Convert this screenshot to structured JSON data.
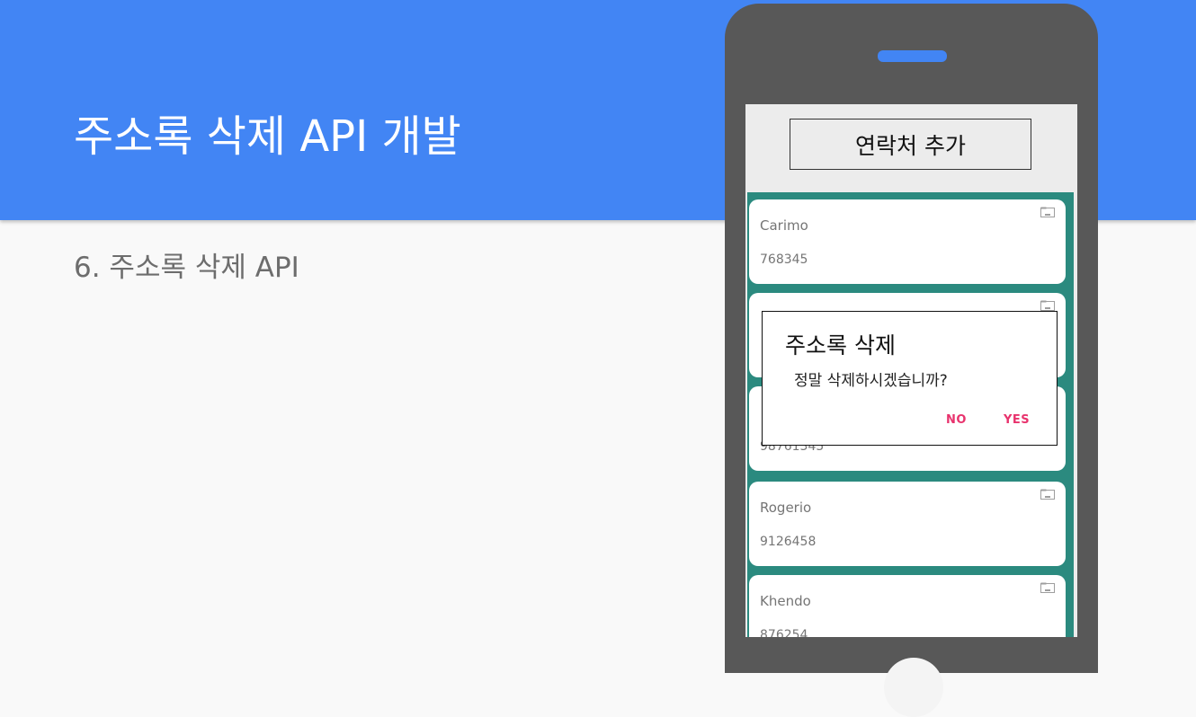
{
  "slide": {
    "title": "주소록 삭제 API 개발",
    "subtitle": "6. 주소록 삭제 API"
  },
  "app": {
    "add_button_label": "연락처 추가",
    "contacts": [
      {
        "name": "Carimo",
        "phone": "768345"
      },
      {
        "name": "",
        "phone": ""
      },
      {
        "name": "",
        "phone": "98761345"
      },
      {
        "name": "Rogerio",
        "phone": "9126458"
      },
      {
        "name": "Khendo",
        "phone": "876254"
      }
    ],
    "dialog": {
      "title": "주소록 삭제",
      "message": "정말 삭제하시겠습니까?",
      "no_label": "NO",
      "yes_label": "YES"
    }
  },
  "colors": {
    "header_bg": "#4285f4",
    "list_bg": "#2b8a7f",
    "dialog_button": "#e8336d",
    "phone_body": "#585858"
  }
}
